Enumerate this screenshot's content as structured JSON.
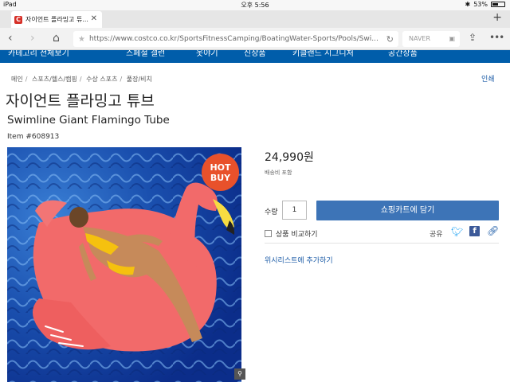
{
  "status_bar": {
    "device": "iPad",
    "time": "오후 5:56",
    "battery": "53%",
    "battery_level": 0.53
  },
  "browser": {
    "tab_title": "자이언트 플라밍고 튜...",
    "favicon_letter": "C",
    "url": "https://www.costco.co.kr/SportsFitnessCamping/BoatingWater-Sports/Pools/Swi...",
    "search_engine": "NAVER"
  },
  "site_nav": [
    "카테고리 전체보기",
    "스페셜 갤런",
    "옷야기",
    "신상품",
    "키클랜드 시그니처",
    "공간상품"
  ],
  "breadcrumb": [
    "메인",
    "스포츠/헬스/캠핑",
    "수상 스포츠",
    "풀장/비치"
  ],
  "print_label": "인쇄",
  "product": {
    "title_ko": "자이언트 플라밍고 튜브",
    "title_en": "Swimline Giant Flamingo Tube",
    "item_no": "Item #608913",
    "badge": [
      "HOT",
      "BUY"
    ],
    "price": "24,990원",
    "shipping_note": "배송비 포함",
    "qty_label": "수량",
    "qty_value": "1",
    "add_to_cart": "쇼핑카트에 담기",
    "compare_label": "상품 비교하기",
    "share_label": "공유",
    "wishlist_label": "위시리스트에 추가하기"
  },
  "colors": {
    "brand_blue": "#005daa",
    "button_blue": "#3d74b7",
    "badge_orange": "#e8512b",
    "link_blue": "#1a5aa6",
    "flamingo_pink": "#f26a6a"
  }
}
